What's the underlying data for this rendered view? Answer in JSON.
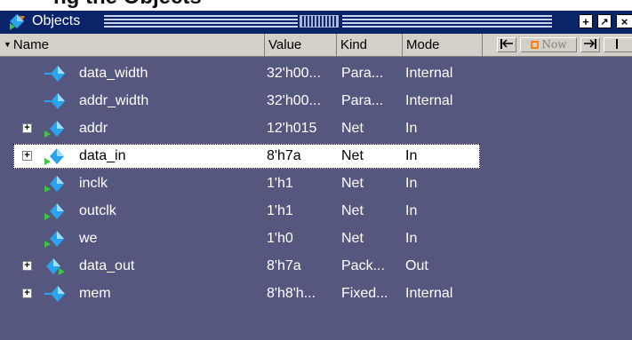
{
  "top_strip": {
    "text": "ng the Objects"
  },
  "window": {
    "title": "Objects",
    "controls": {
      "add": "+",
      "float": "↗",
      "close": "×"
    }
  },
  "columns": {
    "name": "Name",
    "value": "Value",
    "kind": "Kind",
    "mode": "Mode"
  },
  "toolbar": {
    "now_label": "Now"
  },
  "rows": [
    {
      "name": "data_width",
      "value": "32'h00...",
      "kind": "Para...",
      "mode": "Internal",
      "expandable": false,
      "icon": "parameter-diamond-icon"
    },
    {
      "name": "addr_width",
      "value": "32'h00...",
      "kind": "Para...",
      "mode": "Internal",
      "expandable": false,
      "icon": "parameter-diamond-icon"
    },
    {
      "name": "addr",
      "value": "12'h015",
      "kind": "Net",
      "mode": "In",
      "expandable": true,
      "icon": "input-net-icon"
    },
    {
      "name": "data_in",
      "value": "8'h7a",
      "kind": "Net",
      "mode": "In",
      "expandable": true,
      "icon": "input-net-icon",
      "selected": true
    },
    {
      "name": "inclk",
      "value": "1'h1",
      "kind": "Net",
      "mode": "In",
      "expandable": false,
      "icon": "input-net-icon"
    },
    {
      "name": "outclk",
      "value": "1'h1",
      "kind": "Net",
      "mode": "In",
      "expandable": false,
      "icon": "input-net-icon"
    },
    {
      "name": "we",
      "value": "1'h0",
      "kind": "Net",
      "mode": "In",
      "expandable": false,
      "icon": "input-net-icon"
    },
    {
      "name": "data_out",
      "value": "8'h7a",
      "kind": "Pack...",
      "mode": "Out",
      "expandable": true,
      "icon": "output-net-icon"
    },
    {
      "name": "mem",
      "value": "8'h8'h...",
      "kind": "Fixed...",
      "mode": "Internal",
      "expandable": true,
      "icon": "memory-diamond-icon"
    }
  ],
  "colors": {
    "titlebar": "#0a246a",
    "list_background": "#55577f",
    "header_background": "#d4d0c8",
    "icon_blue": "#2aa3ee",
    "icon_green": "#3ec43e"
  }
}
